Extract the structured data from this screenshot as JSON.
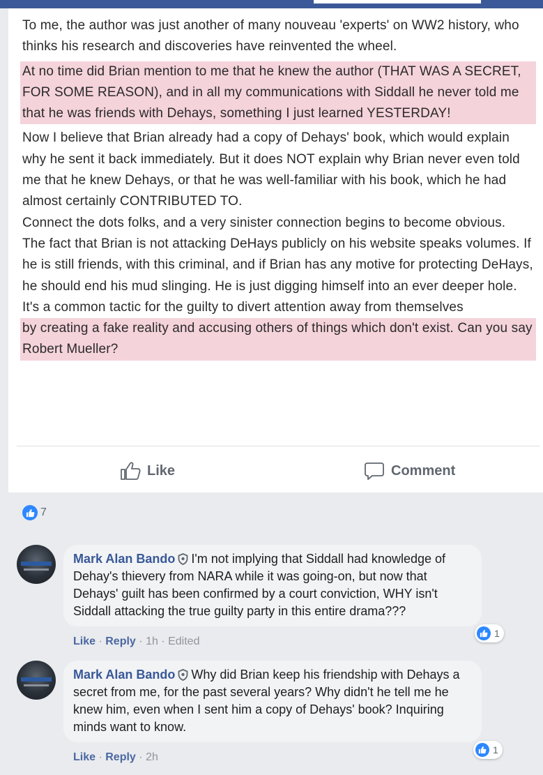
{
  "post": {
    "paragraphs": [
      {
        "text": "To me, the author was just another of many nouveau 'experts' on WW2 history, who thinks his research and discoveries have reinvented the wheel."
      },
      {
        "text": "At no time did Brian mention to me that he knew the author (THAT WAS A SECRET, FOR SOME REASON), and in all my communications with Siddall he never told me that he was friends with Dehays, something I just learned YESTERDAY!"
      },
      {
        "text": "Now I believe that Brian already had a copy of Dehays' book, which would explain why he sent it back immediately. But it does NOT explain why Brian never even told me that he knew Dehays, or that he was well-familiar with his book, which he had almost certainly CONTRIBUTED TO."
      },
      {
        "text": "Connect the dots folks, and a very sinister connection begins to become obvious."
      },
      {
        "text": "The fact that Brian is not attacking DeHays publicly on his website speaks volumes. If he is still friends, with this criminal, and if Brian has any motive for protecting DeHays, he should end his mud slinging. He is just digging himself into an ever deeper hole."
      },
      {
        "text": "It's a common tactic for the guilty to divert attention away from themselves"
      },
      {
        "text": "by creating a fake reality and accusing others of things which don't exist. Can you say Robert Mueller?"
      }
    ]
  },
  "actions": {
    "like_label": "Like",
    "comment_label": "Comment"
  },
  "reactions": {
    "count": "7",
    "icon": "thumbs-up-icon"
  },
  "comments": [
    {
      "author": "Mark Alan Bando",
      "text": "I'm not implying that Siddall had knowledge of Dehay's thievery from NARA while it was going-on, but now that Dehays' guilt has been confirmed by a court conviction, WHY isn't Siddall attacking the true guilty party in this entire drama???",
      "like_label": "Like",
      "reply_label": "Reply",
      "time": "1h",
      "edited": "Edited",
      "reaction_count": "1"
    },
    {
      "author": "Mark Alan Bando",
      "text": "Why did Brian keep his friendship with Dehays a secret from me, for the past several years? Why didn't he tell me he knew him, even when I sent him a copy of Dehays' book? Inquiring minds want to know.",
      "like_label": "Like",
      "reply_label": "Reply",
      "time": "2h",
      "reaction_count": "1"
    }
  ],
  "colors": {
    "highlight": "#f5d3db",
    "link": "#385898",
    "like_blue": "#2d88ff",
    "header_blue": "#3b5998"
  }
}
